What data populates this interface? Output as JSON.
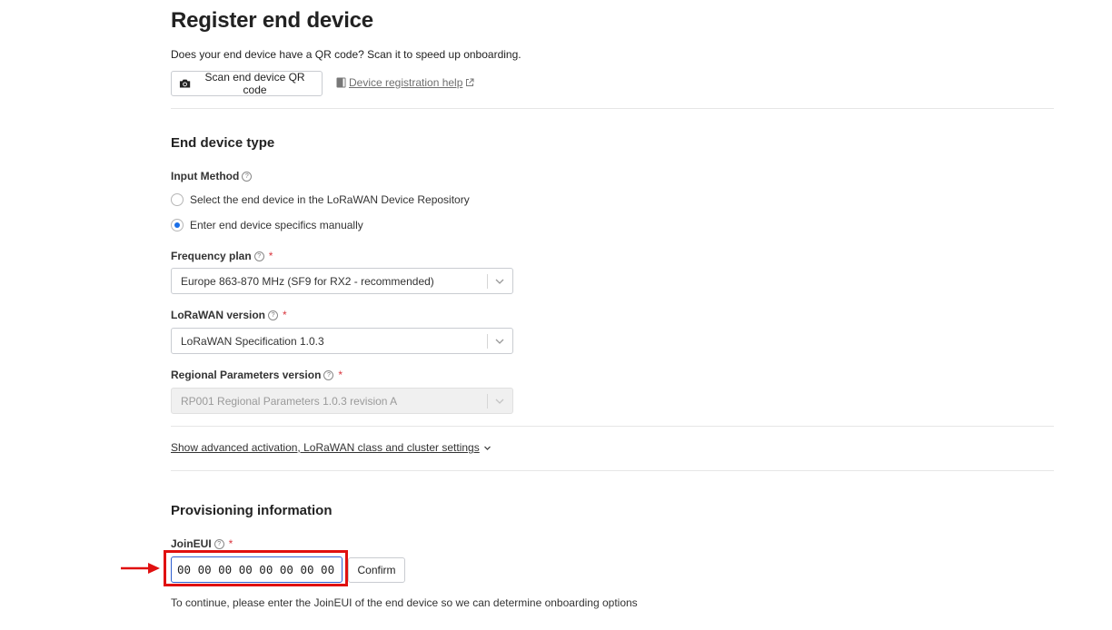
{
  "header": {
    "title": "Register end device",
    "subtitle": "Does your end device have a QR code? Scan it to speed up onboarding.",
    "scan_button": "Scan end device QR code",
    "help_link": "Device registration help"
  },
  "end_device_type": {
    "heading": "End device type",
    "input_method_label": "Input Method",
    "options": [
      "Select the end device in the LoRaWAN Device Repository",
      "Enter end device specifics manually"
    ],
    "selected_option_index": 1,
    "frequency_plan": {
      "label": "Frequency plan",
      "required": "*",
      "value": "Europe 863-870 MHz (SF9 for RX2 - recommended)"
    },
    "lorawan_version": {
      "label": "LoRaWAN version",
      "required": "*",
      "value": "LoRaWAN Specification 1.0.3"
    },
    "regional_parameters": {
      "label": "Regional Parameters version",
      "required": "*",
      "value": "RP001 Regional Parameters 1.0.3 revision A",
      "disabled": true
    },
    "advanced_link": "Show advanced activation, LoRaWAN class and cluster settings"
  },
  "provisioning": {
    "heading": "Provisioning information",
    "join_eui_label": "JoinEUI",
    "required": "*",
    "join_eui_value": "00 00 00 00 00 00 00 00",
    "confirm_button": "Confirm",
    "hint": "To continue, please enter the JoinEUI of the end device so we can determine onboarding options"
  },
  "colors": {
    "accent": "#1a6fe8",
    "required": "#d9363e",
    "highlight": "#e01010"
  },
  "icons": {
    "scan": "camera-icon",
    "help": "book-icon",
    "external": "external-link-icon",
    "info": "question-circle-icon",
    "dropdown": "chevron-down-icon",
    "annotation": "arrow-right-icon"
  }
}
